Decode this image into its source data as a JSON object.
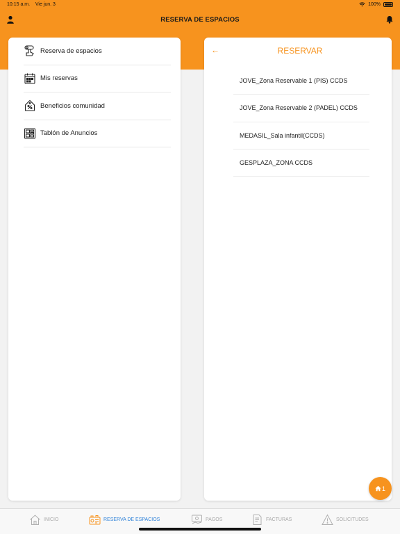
{
  "status_bar": {
    "time": "10:15 a.m.",
    "date": "Vie jun. 3",
    "battery": "100%"
  },
  "header": {
    "title": "RESERVA DE ESPACIOS"
  },
  "menu": {
    "items": [
      {
        "label": "Reserva de espacios",
        "icon": "hand-key-icon"
      },
      {
        "label": "Mis reservas",
        "icon": "calendar-icon"
      },
      {
        "label": "Beneficios comunidad",
        "icon": "discount-tag-icon"
      },
      {
        "label": "Tablón de Anuncios",
        "icon": "bulletin-board-icon"
      }
    ]
  },
  "reservar": {
    "title": "RESERVAR",
    "back": "←",
    "spaces": [
      {
        "label": "JOVE_Zona Reservable 1 (PIS) CCDS"
      },
      {
        "label": "JOVE_Zona Reservable 2 (PADEL) CCDS"
      },
      {
        "label": "MEDASIL_Sala infantil(CCDS)"
      },
      {
        "label": "GESPLAZA_ZONA CCDS"
      }
    ]
  },
  "fab": {
    "count": "1"
  },
  "tabs": [
    {
      "label": "INICIO",
      "active": false
    },
    {
      "label": "RESERVA DE ESPACIOS",
      "active": true
    },
    {
      "label": "PAGOS",
      "active": false
    },
    {
      "label": "FACTURAS",
      "active": false
    },
    {
      "label": "SOLICITUDES",
      "active": false
    }
  ],
  "colors": {
    "accent": "#f7931e",
    "active_tab": "#2a7fd8",
    "inactive_tab": "#a8a8a8"
  }
}
